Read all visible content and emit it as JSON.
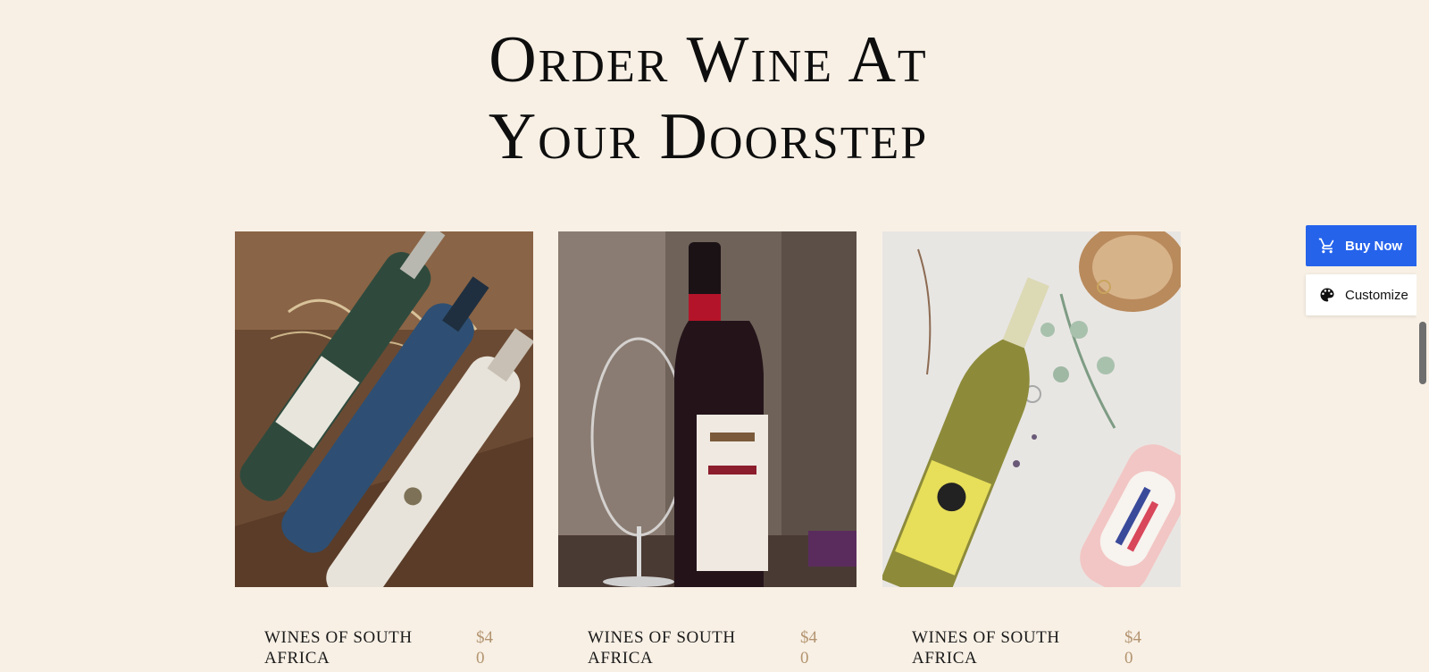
{
  "heading": {
    "line1": "Order Wine At",
    "line2": "Your Doorstep"
  },
  "products": [
    {
      "name": "WINES OF SOUTH AFRICA",
      "price": "$40",
      "image": "wine-crate-photo"
    },
    {
      "name": "WINES OF SOUTH AFRICA",
      "price": "$40",
      "image": "red-wine-bottle-glass-photo"
    },
    {
      "name": "WINES OF SOUTH AFRICA",
      "price": "$40",
      "image": "white-wine-flatlay-photo"
    }
  ],
  "side_actions": {
    "buy_label": "Buy Now",
    "customize_label": "Customize",
    "buy_icon": "cart-icon",
    "customize_icon": "palette-icon"
  },
  "colors": {
    "background": "#f8f0e5",
    "price": "#b39470",
    "buy_button": "#2563eb"
  }
}
